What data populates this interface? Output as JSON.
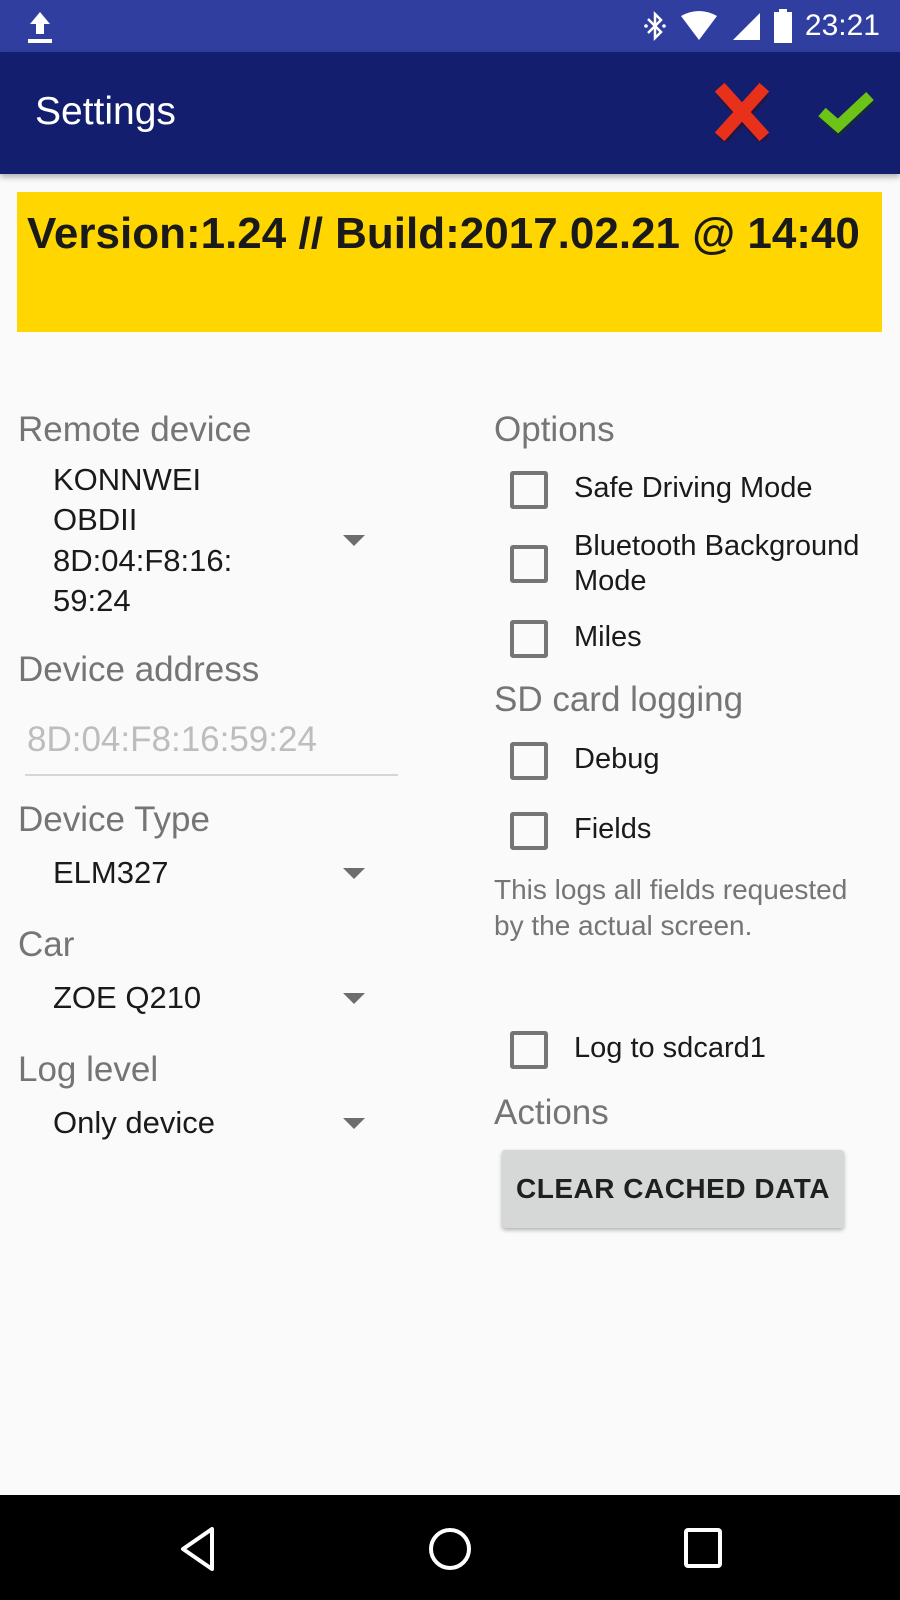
{
  "status_bar": {
    "time": "23:21",
    "icons": [
      "upload-icon",
      "bluetooth-icon",
      "wifi-icon",
      "signal-icon",
      "battery-icon"
    ]
  },
  "app_bar": {
    "title": "Settings",
    "cancel_icon": "red-x-icon",
    "confirm_icon": "green-check-icon",
    "colors": {
      "status_bar": "#303f9f",
      "app_bar": "#131f6e"
    }
  },
  "version_banner": {
    "text": "Version:1.24  //  Build:2017.02.21 @ 14:40",
    "color": "#ffd600"
  },
  "left": {
    "remote_device": {
      "label": "Remote device",
      "value_lines": [
        "KONNWEI",
        "OBDII",
        "8D:04:F8:16:",
        "59:24"
      ]
    },
    "device_address": {
      "label": "Device address",
      "placeholder": "8D:04:F8:16:59:24"
    },
    "device_type": {
      "label": "Device Type",
      "value": "ELM327"
    },
    "car": {
      "label": "Car",
      "value": "ZOE Q210"
    },
    "log_level": {
      "label": "Log level",
      "value": "Only device"
    }
  },
  "right": {
    "options_header": "Options",
    "options": [
      {
        "label": "Safe Driving Mode",
        "checked": false
      },
      {
        "label": "Bluetooth Background Mode",
        "checked": false
      },
      {
        "label": "Miles",
        "checked": false
      }
    ],
    "sd_header": "SD card logging",
    "sd_options": [
      {
        "label": "Debug",
        "checked": false
      },
      {
        "label": "Fields",
        "checked": false
      }
    ],
    "help_text": "This logs all fields requested by the actual screen.",
    "log_to_sdcard": {
      "label": "Log to sdcard1",
      "checked": false
    },
    "actions_header": "Actions",
    "clear_button": "CLEAR CACHED DATA"
  },
  "nav_bar": {
    "buttons": [
      "back-icon",
      "home-icon",
      "recents-icon"
    ]
  }
}
